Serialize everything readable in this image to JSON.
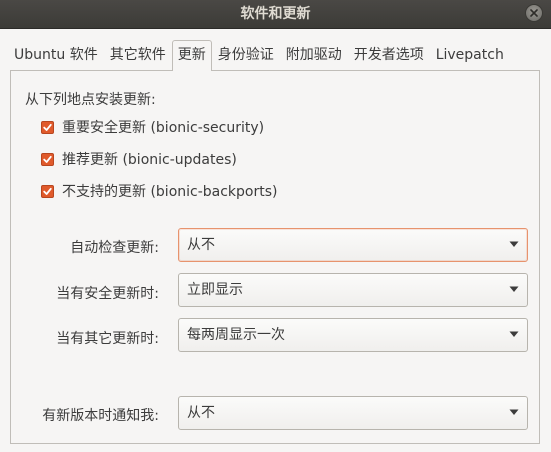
{
  "window": {
    "title": "软件和更新"
  },
  "tabs": [
    {
      "label": "Ubuntu 软件",
      "active": false
    },
    {
      "label": "其它软件",
      "active": false
    },
    {
      "label": "更新",
      "active": true
    },
    {
      "label": "身份验证",
      "active": false
    },
    {
      "label": "附加驱动",
      "active": false
    },
    {
      "label": "开发者选项",
      "active": false
    },
    {
      "label": "Livepatch",
      "active": false
    }
  ],
  "updates": {
    "install_from_label": "从下列地点安装更新:",
    "sources": [
      {
        "label": "重要安全更新 (bionic-security)",
        "checked": true
      },
      {
        "label": "推荐更新 (bionic-updates)",
        "checked": true
      },
      {
        "label": "不支持的更新 (bionic-backports)",
        "checked": true
      }
    ],
    "settings": [
      {
        "label": "自动检查更新:",
        "value": "从不"
      },
      {
        "label": "当有安全更新时:",
        "value": "立即显示"
      },
      {
        "label": "当有其它更新时:",
        "value": "每两周显示一次"
      },
      {
        "label": "有新版本时通知我:",
        "value": "从不"
      }
    ]
  },
  "colors": {
    "accent": "#e05a2b",
    "titlebar": "#3c3b37",
    "background": "#f6f5f4"
  },
  "icons": {
    "close": "close-icon",
    "check": "check-icon",
    "dropdown": "dropdown-arrow-icon"
  }
}
